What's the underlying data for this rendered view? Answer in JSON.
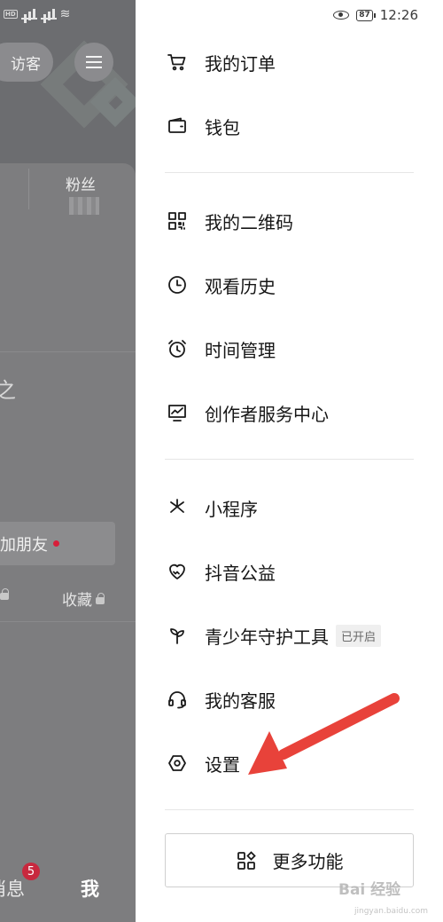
{
  "status_bar": {
    "left_labels": [
      "HD",
      "4G",
      "4G"
    ],
    "battery": "87",
    "time": "12:26"
  },
  "background": {
    "visitor_label": "访客",
    "fans_label": "粉丝",
    "fragment_char": "之",
    "add_friend_label": "加朋友",
    "collect_label": "收藏",
    "message_fragment": "消息",
    "message_badge": "5",
    "me_tab_label": "我"
  },
  "drawer": {
    "groups": [
      [
        {
          "label": "我的订单",
          "icon": "cart-icon"
        },
        {
          "label": "钱包",
          "icon": "wallet-icon"
        }
      ],
      [
        {
          "label": "我的二维码",
          "icon": "qrcode-icon"
        },
        {
          "label": "观看历史",
          "icon": "clock-icon"
        },
        {
          "label": "时间管理",
          "icon": "alarm-clock-icon"
        },
        {
          "label": "创作者服务中心",
          "icon": "chart-monitor-icon"
        }
      ],
      [
        {
          "label": "小程序",
          "icon": "mini-program-icon"
        },
        {
          "label": "抖音公益",
          "icon": "charity-heart-icon"
        },
        {
          "label": "青少年守护工具",
          "icon": "sprout-icon",
          "tag": "已开启"
        },
        {
          "label": "我的客服",
          "icon": "headset-icon"
        },
        {
          "label": "设置",
          "icon": "settings-hexagon-icon"
        }
      ]
    ],
    "more_button_label": "更多功能"
  },
  "annotation": {
    "arrow_color": "#e8423a"
  },
  "watermark": {
    "text": "Bai 经验",
    "sub": "jingyan.baidu.com"
  }
}
